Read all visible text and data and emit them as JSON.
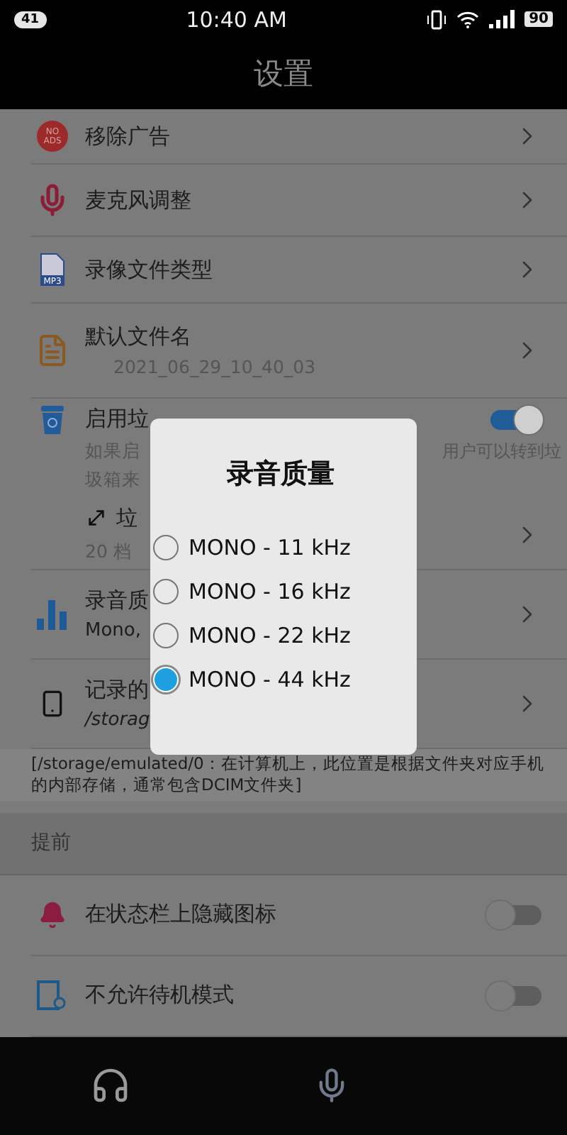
{
  "status_bar": {
    "notification_count": "41",
    "time": "10:40 AM",
    "battery": "90"
  },
  "header": {
    "title": "设置"
  },
  "settings": [
    {
      "kind": "link",
      "icon_lines": [
        "NO",
        "ADS"
      ],
      "title": "移除广告"
    },
    {
      "kind": "link",
      "title": "麦克风调整"
    },
    {
      "kind": "link",
      "icon_label": "MP3",
      "title": "录像文件类型"
    },
    {
      "kind": "link",
      "title": "默认文件名",
      "subtitle": "2021_06_29_10_40_03"
    },
    {
      "kind": "trash",
      "title": "启用垃",
      "on": true,
      "description_left": "如果启",
      "description_right": "用户可以转到垃",
      "description_line2": "圾箱来",
      "sub_title": "垃",
      "sub_value": "20 档"
    },
    {
      "kind": "link",
      "title": "录音质",
      "subtitle": "Mono,"
    },
    {
      "kind": "link",
      "title": "记录的",
      "subtitle": "/storag"
    }
  ],
  "note": "[/storage/emulated/0：在计算机上，此位置是根据文件夹对应手机的内部存储，通常包含DCIM文件夹]",
  "section": {
    "title": "提前",
    "rows": [
      {
        "title": "在状态栏上隐藏图标",
        "on": false
      },
      {
        "title": "不允许待机模式",
        "on": false
      }
    ]
  },
  "dialog": {
    "title": "录音质量",
    "options": [
      {
        "label": "MONO - 11 kHz",
        "selected": false
      },
      {
        "label": "MONO - 16 kHz",
        "selected": false
      },
      {
        "label": "MONO - 22 kHz",
        "selected": false
      },
      {
        "label": "MONO - 44 kHz",
        "selected": true
      }
    ]
  }
}
